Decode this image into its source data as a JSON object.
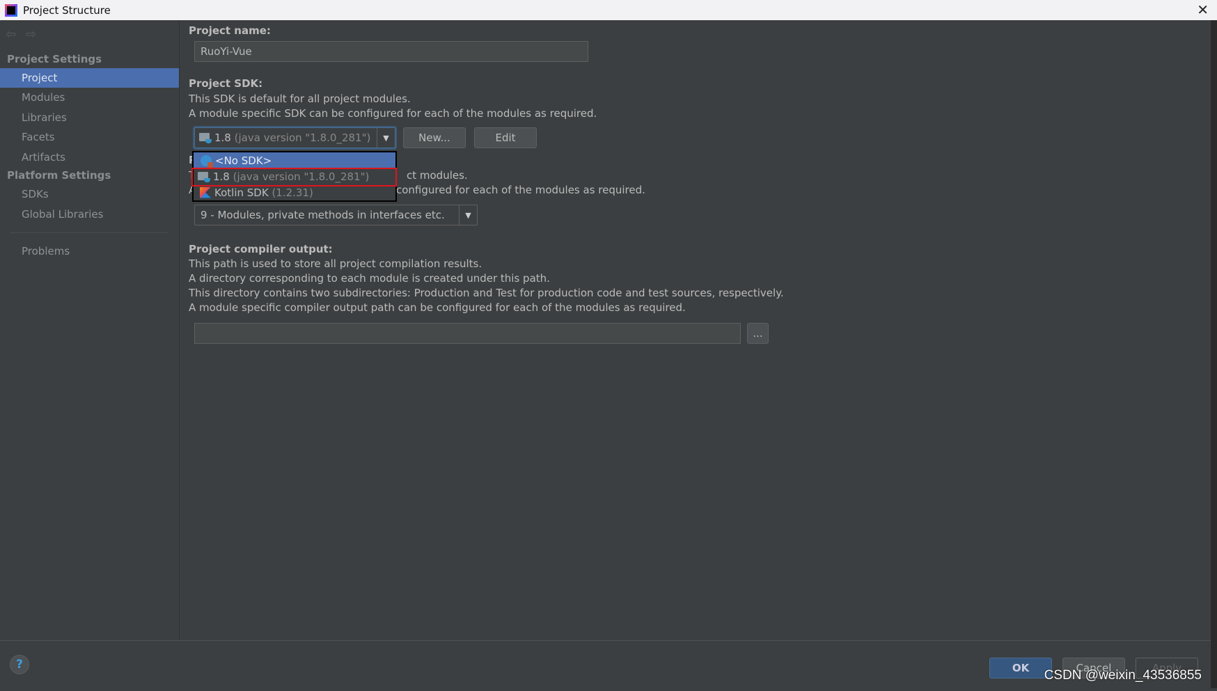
{
  "window": {
    "title": "Project Structure"
  },
  "sidebar": {
    "project_settings": "Project Settings",
    "items": [
      {
        "label": "Project",
        "selected": true
      },
      {
        "label": "Modules"
      },
      {
        "label": "Libraries"
      },
      {
        "label": "Facets"
      },
      {
        "label": "Artifacts"
      }
    ],
    "platform_settings": "Platform Settings",
    "platform_items": [
      {
        "label": "SDKs"
      },
      {
        "label": "Global Libraries"
      }
    ],
    "problems": "Problems"
  },
  "main": {
    "project_name_label": "Project name:",
    "project_name_value": "RuoYi-Vue",
    "sdk_label": "Project SDK:",
    "sdk_desc1": "This SDK is default for all project modules.",
    "sdk_desc2": "A module specific SDK can be configured for each of the modules as required.",
    "sdk_selected_name": "1.8",
    "sdk_selected_detail": "(java version \"1.8.0_281\")",
    "new_button": "New...",
    "edit_button": "Edit",
    "sdk_options": [
      {
        "name": "<No SDK>",
        "detail": "",
        "icon": "no-sdk-icon",
        "highlighted": true
      },
      {
        "name": "1.8",
        "detail": "(java version \"1.8.0_281\")",
        "icon": "jdk-folder-icon",
        "outlined": true
      },
      {
        "name": "Kotlin SDK",
        "detail": "(1.2.31)",
        "icon": "kotlin-icon"
      }
    ],
    "lang_label": "P",
    "lang_desc1_tail": "ct modules.",
    "lang_desc2_head": "A",
    "lang_desc2_tail": "configured for each of the modules as required.",
    "lang_desc1_head": "T",
    "lang_level_value": "9 - Modules, private methods in interfaces etc.",
    "compiler_label": "Project compiler output:",
    "compiler_desc": [
      "This path is used to store all project compilation results.",
      "A directory corresponding to each module is created under this path.",
      "This directory contains two subdirectories: Production and Test for production code and test sources, respectively.",
      "A module specific compiler output path can be configured for each of the modules as required."
    ],
    "compiler_output_value": "",
    "browse_button": "..."
  },
  "footer": {
    "help": "?",
    "ok": "OK",
    "cancel": "Cancel",
    "apply": "Apply"
  },
  "watermark": "CSDN @weixin_43536855",
  "colors": {
    "selection": "#4b6eaf",
    "background": "#3c3f41",
    "highlight_outline": "#e0141e",
    "ok_button": "#365880"
  }
}
